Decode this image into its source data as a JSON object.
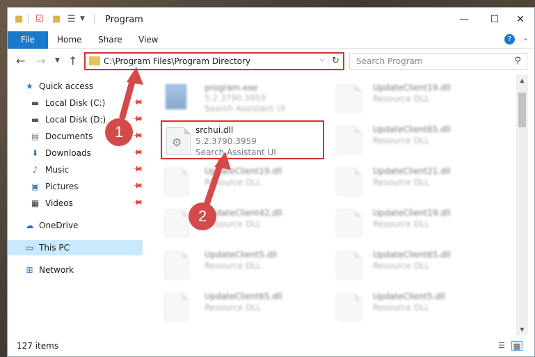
{
  "window": {
    "title": "Program",
    "controls": {
      "minimize": "—",
      "maximize": "☐",
      "close": "✕"
    }
  },
  "ribbon": {
    "tabs": [
      "File",
      "Home",
      "Share",
      "View"
    ]
  },
  "address": {
    "path": "C:\\Program Files\\Program Directory"
  },
  "search": {
    "placeholder": "Search Program"
  },
  "navpane": {
    "quick_access": "Quick access",
    "items": [
      {
        "label": "Local Disk (C:)",
        "icon": "drive-icon"
      },
      {
        "label": "Local Disk (D:)",
        "icon": "drive-icon"
      },
      {
        "label": "Documents",
        "icon": "documents-icon"
      },
      {
        "label": "Downloads",
        "icon": "downloads-icon"
      },
      {
        "label": "Music",
        "icon": "music-icon"
      },
      {
        "label": "Pictures",
        "icon": "pictures-icon"
      },
      {
        "label": "Videos",
        "icon": "videos-icon"
      }
    ],
    "onedrive": "OneDrive",
    "this_pc": "This PC",
    "network": "Network"
  },
  "files": {
    "left": [
      {
        "name": "program.exe",
        "line1": "5.2.3790.3959",
        "line2": "Search Assistant UI"
      },
      {
        "name": "srchui.dll",
        "line1": "5.2.3790.3959",
        "line2": "Search Assistant UI"
      },
      {
        "name": "UpdateClient19.dll",
        "line1": "Resource DLL"
      },
      {
        "name": "UpdateClient42.dll",
        "line1": "Resource DLL"
      },
      {
        "name": "UpdateClient5.dll",
        "line1": "Resource DLL"
      },
      {
        "name": "UpdateClient65.dll",
        "line1": "Resource DLL"
      }
    ],
    "right": [
      {
        "name": "UpdateClient19.dll",
        "line1": "Resource DLL"
      },
      {
        "name": "UpdateClient65.dll",
        "line1": "Resource DLL"
      },
      {
        "name": "UpdateClient21.dll",
        "line1": "Resource DLL"
      },
      {
        "name": "UpdateClient19.dll",
        "line1": "Resource DLL"
      },
      {
        "name": "UpdateClient65.dll",
        "line1": "Resource DLL"
      },
      {
        "name": "UpdateClient5.dll",
        "line1": "Resource DLL"
      }
    ]
  },
  "status": {
    "count": "127 items"
  },
  "callouts": [
    "1",
    "2"
  ],
  "colors": {
    "accent": "#1979ca",
    "highlight": "#d63131",
    "callout": "#d44a4a",
    "selected": "#cce8ff"
  }
}
